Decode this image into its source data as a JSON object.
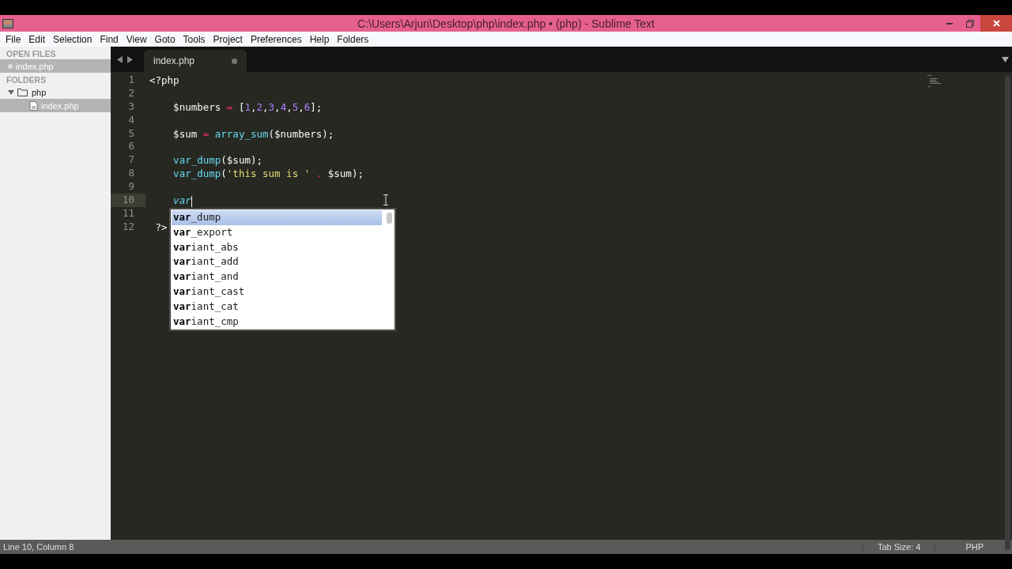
{
  "window": {
    "title": "C:\\Users\\Arjun\\Desktop\\php\\index.php • (php) - Sublime Text"
  },
  "menu": [
    "File",
    "Edit",
    "Selection",
    "Find",
    "View",
    "Goto",
    "Tools",
    "Project",
    "Preferences",
    "Help",
    "Folders"
  ],
  "sidebar": {
    "open_files_heading": "OPEN FILES",
    "open_files": [
      {
        "name": "index.php",
        "selected": true
      }
    ],
    "folders_heading": "FOLDERS",
    "folders": [
      {
        "name": "php",
        "expanded": true,
        "children": [
          {
            "name": "index.php",
            "selected": true
          }
        ]
      }
    ]
  },
  "tabs": [
    {
      "label": "index.php",
      "selected": true,
      "dirty": true
    }
  ],
  "editor": {
    "lines": [
      {
        "number": "1",
        "current": false,
        "tokens": [
          {
            "kind": "tag",
            "text": "<?php"
          }
        ]
      },
      {
        "number": "2",
        "current": false
      },
      {
        "number": "3",
        "current": false,
        "tokens": [
          {
            "kind": "plain",
            "text": "    $numbers "
          },
          {
            "kind": "op",
            "text": "="
          },
          {
            "kind": "plain",
            "text": " ["
          },
          {
            "kind": "num",
            "text": "1"
          },
          {
            "kind": "plain",
            "text": ","
          },
          {
            "kind": "num",
            "text": "2"
          },
          {
            "kind": "plain",
            "text": ","
          },
          {
            "kind": "num",
            "text": "3"
          },
          {
            "kind": "plain",
            "text": ","
          },
          {
            "kind": "num",
            "text": "4"
          },
          {
            "kind": "plain",
            "text": ","
          },
          {
            "kind": "num",
            "text": "5"
          },
          {
            "kind": "plain",
            "text": ","
          },
          {
            "kind": "num",
            "text": "6"
          },
          {
            "kind": "plain",
            "text": "];"
          }
        ]
      },
      {
        "number": "4",
        "current": false
      },
      {
        "number": "5",
        "current": false,
        "tokens": [
          {
            "kind": "plain",
            "text": "    $sum "
          },
          {
            "kind": "op",
            "text": "= "
          },
          {
            "kind": "func",
            "text": "array_sum"
          },
          {
            "kind": "plain",
            "text": "($numbers);"
          }
        ]
      },
      {
        "number": "6",
        "current": false
      },
      {
        "number": "7",
        "current": false,
        "tokens": [
          {
            "kind": "func",
            "text": "    var_dump"
          },
          {
            "kind": "plain",
            "text": "($sum);"
          }
        ]
      },
      {
        "number": "8",
        "current": false,
        "tokens": [
          {
            "kind": "func",
            "text": "    var_dump"
          },
          {
            "kind": "plain",
            "text": "("
          },
          {
            "kind": "str",
            "text": "'this sum is '"
          },
          {
            "kind": "op",
            "text": " . "
          },
          {
            "kind": "plain",
            "text": "$sum);"
          }
        ]
      },
      {
        "number": "9",
        "current": false
      },
      {
        "number": "10",
        "current": true,
        "tokens": [
          {
            "kind": "typing",
            "text": "    var"
          }
        ]
      },
      {
        "number": "11",
        "current": false
      },
      {
        "number": "12",
        "current": false,
        "tokens": [
          {
            "kind": "plain",
            "text": " ?>"
          }
        ]
      }
    ]
  },
  "autocomplete": [
    {
      "text": "**var**_dump",
      "selected": true
    },
    {
      "text": "**var**_export",
      "selected": false
    },
    {
      "text": "**var**iant_abs",
      "selected": false
    },
    {
      "text": "**var**iant_add",
      "selected": false
    },
    {
      "text": "**var**iant_and",
      "selected": false
    },
    {
      "text": "**var**iant_cast",
      "selected": false
    },
    {
      "text": "**var**iant_cat",
      "selected": false
    },
    {
      "text": "**var**iant_cmp",
      "selected": false
    }
  ],
  "status_bar": {
    "position": "Line 10, Column 8",
    "tab_size": "Tab Size: 4",
    "syntax": "PHP"
  }
}
